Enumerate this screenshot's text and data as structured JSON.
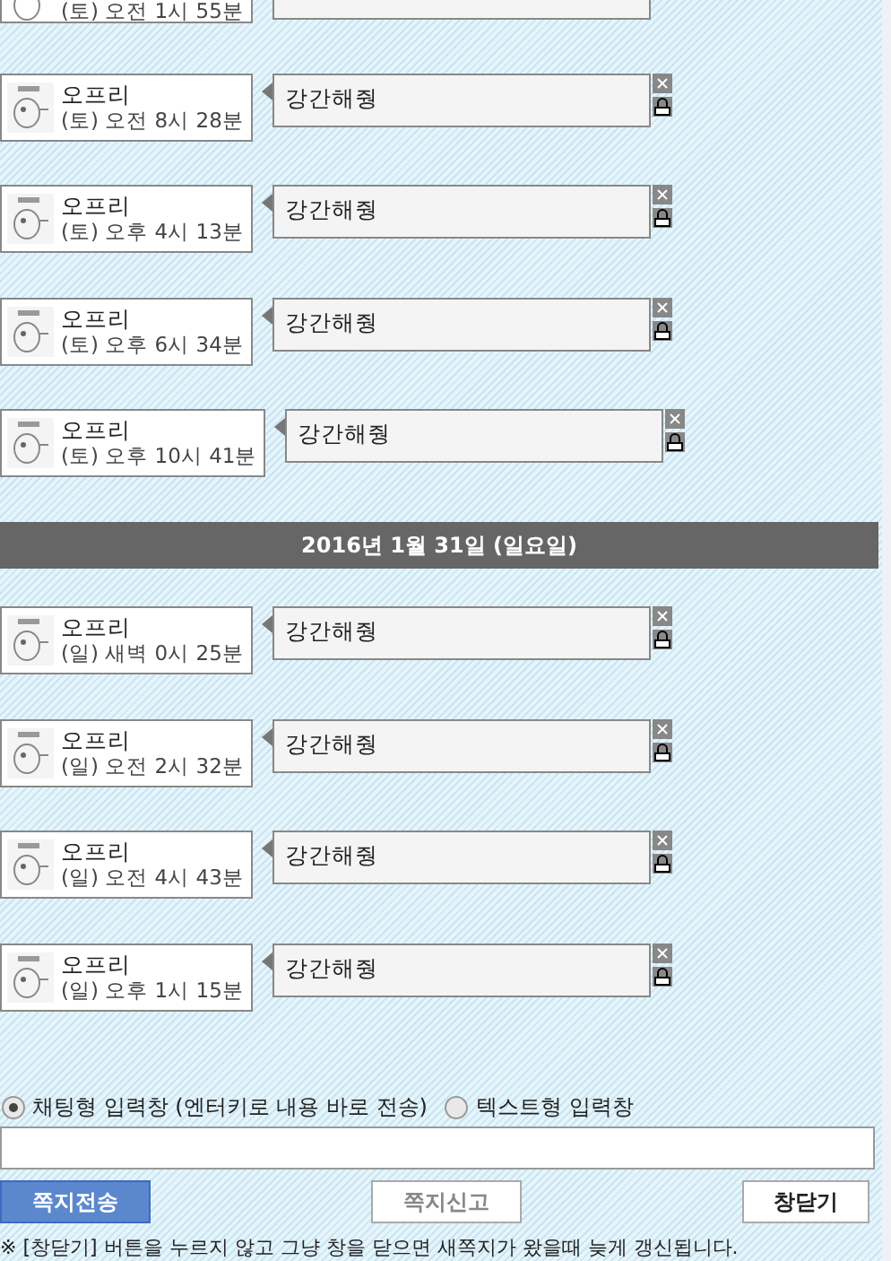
{
  "partial_message": {
    "time": "(토) 오전 1시 55분"
  },
  "sections": [
    {
      "messages": [
        {
          "sender": "오프리",
          "time": "(토) 오전 8시 28분",
          "text": "강간해줭"
        },
        {
          "sender": "오프리",
          "time": "(토) 오후 4시 13분",
          "text": "강간해줭"
        },
        {
          "sender": "오프리",
          "time": "(토) 오후 6시 34분",
          "text": "강간해줭"
        },
        {
          "sender": "오프리",
          "time": "(토) 오후 10시 41분",
          "text": "강간해줭"
        }
      ]
    },
    {
      "date": "2016년 1월 31일 (일요일)",
      "messages": [
        {
          "sender": "오프리",
          "time": "(일) 새벽 0시 25분",
          "text": "강간해줭"
        },
        {
          "sender": "오프리",
          "time": "(일) 오전 2시 32분",
          "text": "강간해줭"
        },
        {
          "sender": "오프리",
          "time": "(일) 오전 4시 43분",
          "text": "강간해줭"
        },
        {
          "sender": "오프리",
          "time": "(일) 오후 1시 15분",
          "text": "강간해줭"
        }
      ]
    }
  ],
  "input_modes": [
    {
      "label": "채팅형 입력창 (엔터키로 내용 바로 전송)",
      "selected": true
    },
    {
      "label": "텍스트형 입력창",
      "selected": false
    }
  ],
  "buttons": [
    {
      "label": "쪽지전송",
      "kind": "primary"
    },
    {
      "label": "쪽지신고",
      "kind": "muted"
    },
    {
      "label": "창닫기",
      "kind": "plain"
    }
  ],
  "note": "※ [창닫기] 버튼을 누르지 않고 그냥 창을 닫으면 새쪽지가 왔을때 늦게 갱신됩니다."
}
